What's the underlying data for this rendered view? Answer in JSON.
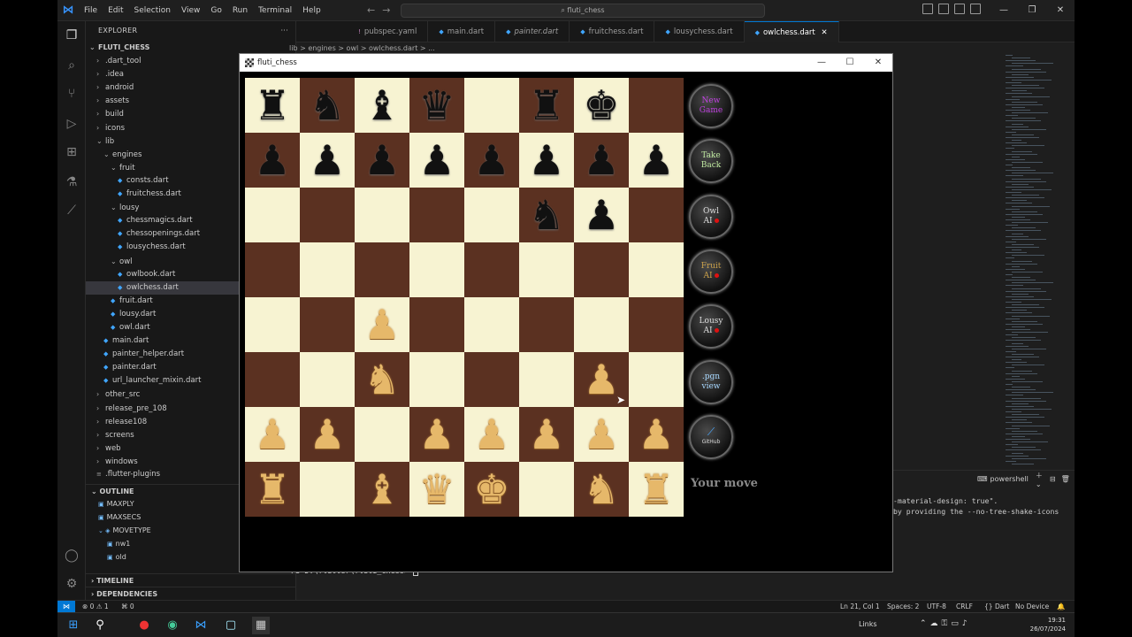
{
  "vscode": {
    "menu": [
      "File",
      "Edit",
      "Selection",
      "View",
      "Go",
      "Run",
      "Terminal",
      "Help"
    ],
    "command_center": "fluti_chess",
    "tabs": [
      {
        "label": "pubspec.yaml",
        "italic": false,
        "active": false
      },
      {
        "label": "main.dart",
        "italic": false,
        "active": false
      },
      {
        "label": "painter.dart",
        "italic": true,
        "active": false
      },
      {
        "label": "fruitchess.dart",
        "italic": false,
        "active": false
      },
      {
        "label": "lousychess.dart",
        "italic": false,
        "active": false
      },
      {
        "label": "owlchess.dart",
        "italic": false,
        "active": true
      }
    ],
    "breadcrumb": "lib > engines > owl > owlchess.dart > ..."
  },
  "explorer": {
    "title": "EXPLORER",
    "project": "FLUTI_CHESS",
    "items": [
      {
        "label": ".dart_tool",
        "indent": 1,
        "kind": "folder",
        "open": false
      },
      {
        "label": ".idea",
        "indent": 1,
        "kind": "folder",
        "open": false
      },
      {
        "label": "android",
        "indent": 1,
        "kind": "folder",
        "open": false
      },
      {
        "label": "assets",
        "indent": 1,
        "kind": "folder",
        "open": false
      },
      {
        "label": "build",
        "indent": 1,
        "kind": "folder",
        "open": false
      },
      {
        "label": "icons",
        "indent": 1,
        "kind": "folder",
        "open": false
      },
      {
        "label": "lib",
        "indent": 1,
        "kind": "folder",
        "open": true
      },
      {
        "label": "engines",
        "indent": 2,
        "kind": "folder",
        "open": true
      },
      {
        "label": "fruit",
        "indent": 3,
        "kind": "folder",
        "open": true
      },
      {
        "label": "consts.dart",
        "indent": 4,
        "kind": "dart"
      },
      {
        "label": "fruitchess.dart",
        "indent": 4,
        "kind": "dart"
      },
      {
        "label": "lousy",
        "indent": 3,
        "kind": "folder",
        "open": true
      },
      {
        "label": "chessmagics.dart",
        "indent": 4,
        "kind": "dart"
      },
      {
        "label": "chessopenings.dart",
        "indent": 4,
        "kind": "dart"
      },
      {
        "label": "lousychess.dart",
        "indent": 4,
        "kind": "dart"
      },
      {
        "label": "owl",
        "indent": 3,
        "kind": "folder",
        "open": true
      },
      {
        "label": "owlbook.dart",
        "indent": 4,
        "kind": "dart"
      },
      {
        "label": "owlchess.dart",
        "indent": 4,
        "kind": "dart",
        "selected": true
      },
      {
        "label": "fruit.dart",
        "indent": 3,
        "kind": "dart"
      },
      {
        "label": "lousy.dart",
        "indent": 3,
        "kind": "dart"
      },
      {
        "label": "owl.dart",
        "indent": 3,
        "kind": "dart"
      },
      {
        "label": "main.dart",
        "indent": 2,
        "kind": "dart"
      },
      {
        "label": "painter_helper.dart",
        "indent": 2,
        "kind": "dart"
      },
      {
        "label": "painter.dart",
        "indent": 2,
        "kind": "dart"
      },
      {
        "label": "url_launcher_mixin.dart",
        "indent": 2,
        "kind": "dart"
      },
      {
        "label": "other_src",
        "indent": 1,
        "kind": "folder",
        "open": false
      },
      {
        "label": "release_pre_108",
        "indent": 1,
        "kind": "folder",
        "open": false
      },
      {
        "label": "release108",
        "indent": 1,
        "kind": "folder",
        "open": false
      },
      {
        "label": "screens",
        "indent": 1,
        "kind": "folder",
        "open": false
      },
      {
        "label": "web",
        "indent": 1,
        "kind": "folder",
        "open": false
      },
      {
        "label": "windows",
        "indent": 1,
        "kind": "folder",
        "open": false
      },
      {
        "label": ".flutter-plugins",
        "indent": 1,
        "kind": "file"
      }
    ],
    "outline_title": "OUTLINE",
    "outline": [
      {
        "label": "MAXPLY",
        "indent": 1
      },
      {
        "label": "MAXSECS",
        "indent": 1
      },
      {
        "label": "MOVETYPE",
        "indent": 1
      },
      {
        "label": "nw1",
        "indent": 2
      },
      {
        "label": "old",
        "indent": 2
      }
    ],
    "timeline": "TIMELINE",
    "dependencies": "DEPENDENCIES"
  },
  "terminal": {
    "shell": "powershell",
    "lines": [
      "-material-design: true\".",
      "by providing the --no-tree-shake-icons"
    ],
    "prompt_line": "PS D:\\flutter\\fluti_chess> "
  },
  "status_bar": {
    "problems": "⊗ 0 ⚠ 1",
    "ports": "⌘ 0",
    "cursor": "Ln 21, Col 1",
    "spaces": "Spaces: 2",
    "encoding": "UTF-8",
    "eol": "CRLF",
    "language": "Dart",
    "device": "No Device"
  },
  "taskbar": {
    "links": "Links",
    "time": "19:31",
    "date": "26/07/2024"
  },
  "app": {
    "title": "fluti_chess",
    "status": "Your move",
    "board": [
      [
        "bR",
        "bN",
        "bB",
        "bQ",
        "",
        "bR",
        "bK",
        ""
      ],
      [
        "bP",
        "bP",
        "bP",
        "bP",
        "bP",
        "bP",
        "bP",
        "bP"
      ],
      [
        "",
        "",
        "",
        "",
        "",
        "bN",
        "bP",
        ""
      ],
      [
        "",
        "",
        "",
        "",
        "",
        "",
        "",
        ""
      ],
      [
        "",
        "",
        "wP",
        "",
        "",
        "",
        "",
        ""
      ],
      [
        "",
        "",
        "wN",
        "",
        "",
        "",
        "wP",
        ""
      ],
      [
        "wP",
        "wP",
        "",
        "wP",
        "wP",
        "wP",
        "wP",
        "wP"
      ],
      [
        "wR",
        "",
        "wB",
        "wQ",
        "wK",
        "",
        "wN",
        "wR"
      ]
    ],
    "buttons": [
      {
        "name": "new-game-button",
        "lines": [
          "New",
          "Game"
        ],
        "color": "#c040e0",
        "dot": false
      },
      {
        "name": "take-back-button",
        "lines": [
          "Take",
          "Back"
        ],
        "color": "#bfe8a0",
        "dot": false
      },
      {
        "name": "owl-ai-button",
        "lines": [
          "Owl",
          "AI"
        ],
        "color": "#dddddd",
        "dot": true
      },
      {
        "name": "fruit-ai-button",
        "lines": [
          "Fruit",
          "AI"
        ],
        "color": "#c9a04a",
        "dot": true
      },
      {
        "name": "lousy-ai-button",
        "lines": [
          "Lousy",
          "AI"
        ],
        "color": "#dddddd",
        "dot": true
      },
      {
        "name": "pgn-view-button",
        "lines": [
          ".pgn",
          "view"
        ],
        "color": "#a8d8ff",
        "dot": false
      },
      {
        "name": "github-button",
        "lines": [
          "GitHub"
        ],
        "color": "#dddddd",
        "dot": false
      }
    ],
    "colors": {
      "light_square": "#f7f3d2",
      "dark_square": "#5b3121"
    }
  }
}
